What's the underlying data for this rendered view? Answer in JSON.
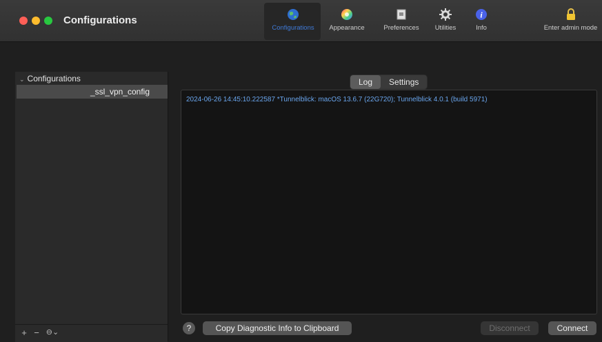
{
  "window": {
    "title": "Configurations"
  },
  "toolbar": {
    "items": [
      {
        "label": "Configurations",
        "icon": "globe-icon",
        "selected": true
      },
      {
        "label": "Appearance",
        "icon": "color-wheel-icon"
      },
      {
        "label": "Preferences",
        "icon": "preferences-icon"
      },
      {
        "label": "Utilities",
        "icon": "gear-icon"
      },
      {
        "label": "Info",
        "icon": "info-icon"
      },
      {
        "label": "Enter admin mode",
        "icon": "lock-icon"
      }
    ]
  },
  "sidebar": {
    "group_label": "Configurations",
    "items": [
      {
        "label": "_ssl_vpn_config",
        "selected": true
      }
    ],
    "bottom_buttons": [
      "+",
      "−",
      "⊖⌄"
    ]
  },
  "tabs": [
    {
      "label": "Log",
      "active": true
    },
    {
      "label": "Settings",
      "active": false
    }
  ],
  "log": {
    "lines": [
      "2024-06-26 14:45:10.222587 *Tunnelblick: macOS 13.6.7 (22G720); Tunnelblick 4.0.1 (build 5971)"
    ]
  },
  "footer": {
    "help_label": "?",
    "copy_label": "Copy Diagnostic Info to Clipboard",
    "disconnect_label": "Disconnect",
    "connect_label": "Connect"
  },
  "colors": {
    "accent": "#3f7ad8",
    "log_text": "#6aa6ee",
    "close": "#ff5f57",
    "minimize": "#febc2e",
    "maximize": "#28c840"
  }
}
